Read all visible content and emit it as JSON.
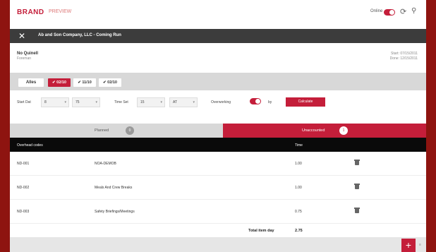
{
  "header": {
    "brand": "BRAND",
    "brand_sub": "PREVIEW",
    "online_label": "Online",
    "icons": {
      "sync": "sync-icon",
      "user": "user-settings-icon"
    }
  },
  "job_bar": {
    "title": "Ab and Son Company, LLC - Coming Run"
  },
  "info": {
    "rep_name": "No Quinell",
    "rep_role": "Foreman",
    "date_start": "Start: 07/15/2011",
    "date_end": "Done: 12/15/2011"
  },
  "days": {
    "all_label": "Alles",
    "chips": [
      {
        "label": "✔ 02/10",
        "active": true
      },
      {
        "label": "✔ 11/10",
        "active": false
      },
      {
        "label": "✔ 02/10",
        "active": false
      }
    ]
  },
  "time": {
    "start_label": "Start Dat",
    "start_hour": "8",
    "start_min": "75",
    "stop_label": "Time Set",
    "stop_hour": "15",
    "stop_min": "AT",
    "overtime_label": "Overworking",
    "overtime_suffix": "by",
    "calculate_label": "Calculate"
  },
  "tabs": {
    "left_label": "Planned",
    "left_badge": "0",
    "right_label": "Unaccounted",
    "right_badge": "1"
  },
  "table": {
    "headers": {
      "code": "Overhead codes",
      "hours": "Time"
    },
    "rows": [
      {
        "code": "ND-001",
        "desc": "NOA-DEMOB",
        "hours": "1.00"
      },
      {
        "code": "ND-002",
        "desc": "Meals And Crew Breaks",
        "hours": "1.00"
      },
      {
        "code": "ND-003",
        "desc": "Safety Briefings/Meetings",
        "hours": "0.75"
      }
    ],
    "total_label": "Total item day",
    "total_value": "2.75"
  },
  "footer": {
    "add_label": "+",
    "side_label": "≡"
  },
  "colors": {
    "accent": "#c41e3a",
    "frame": "#8e1410",
    "dark_bar": "#3c3c3c",
    "table_header": "#0a0a0a"
  }
}
